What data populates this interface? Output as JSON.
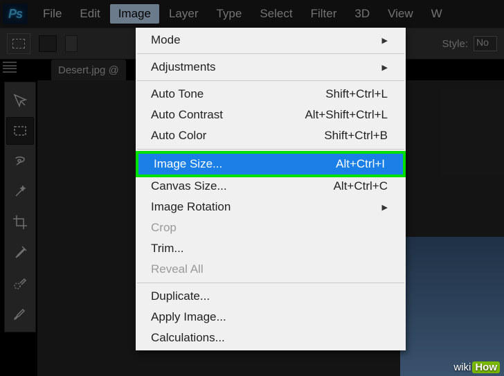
{
  "app": {
    "logo": "Ps"
  },
  "menubar": {
    "items": [
      "File",
      "Edit",
      "Image",
      "Layer",
      "Type",
      "Select",
      "Filter",
      "3D",
      "View",
      "W"
    ],
    "active_index": 2
  },
  "options": {
    "style_label": "Style:",
    "style_value": "No"
  },
  "document": {
    "tab_label": "Desert.jpg @"
  },
  "tools": [
    {
      "name": "move",
      "selected": false
    },
    {
      "name": "marquee",
      "selected": true
    },
    {
      "name": "lasso",
      "selected": false
    },
    {
      "name": "magic-wand",
      "selected": false
    },
    {
      "name": "crop",
      "selected": false
    },
    {
      "name": "eyedropper",
      "selected": false
    },
    {
      "name": "healing-brush",
      "selected": false
    },
    {
      "name": "brush",
      "selected": false
    }
  ],
  "dropdown": {
    "rows": [
      {
        "label": "Mode",
        "shortcut": "",
        "arrow": true,
        "sep_after": true
      },
      {
        "label": "Adjustments",
        "shortcut": "",
        "arrow": true,
        "sep_after": true
      },
      {
        "label": "Auto Tone",
        "shortcut": "Shift+Ctrl+L"
      },
      {
        "label": "Auto Contrast",
        "shortcut": "Alt+Shift+Ctrl+L"
      },
      {
        "label": "Auto Color",
        "shortcut": "Shift+Ctrl+B",
        "sep_after": true
      },
      {
        "label": "Image Size...",
        "shortcut": "Alt+Ctrl+I",
        "highlighted": true
      },
      {
        "label": "Canvas Size...",
        "shortcut": "Alt+Ctrl+C"
      },
      {
        "label": "Image Rotation",
        "shortcut": "",
        "arrow": true
      },
      {
        "label": "Crop",
        "shortcut": "",
        "disabled": true
      },
      {
        "label": "Trim...",
        "shortcut": ""
      },
      {
        "label": "Reveal All",
        "shortcut": "",
        "disabled": true,
        "sep_after": true
      },
      {
        "label": "Duplicate...",
        "shortcut": ""
      },
      {
        "label": "Apply Image...",
        "shortcut": ""
      },
      {
        "label": "Calculations...",
        "shortcut": ""
      }
    ]
  },
  "watermark": {
    "wiki": "wiki",
    "how": "How"
  }
}
